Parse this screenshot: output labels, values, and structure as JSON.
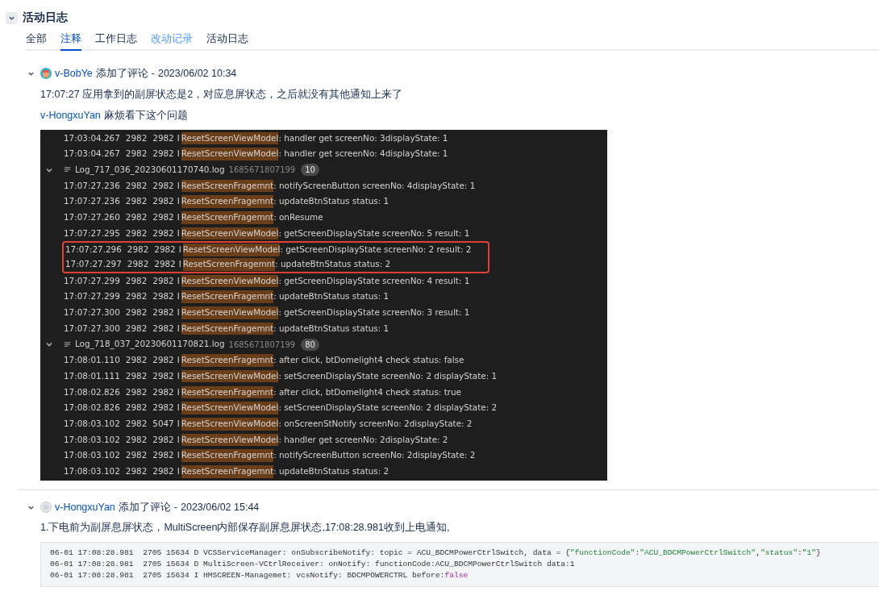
{
  "section": {
    "title": "活动日志",
    "expanded": true
  },
  "tabs": [
    {
      "label": "全部",
      "selected": false,
      "kind": "plain"
    },
    {
      "label": "注释",
      "selected": true,
      "kind": "plain"
    },
    {
      "label": "工作日志",
      "selected": false,
      "kind": "plain"
    },
    {
      "label": "改动记录",
      "selected": false,
      "kind": "link"
    },
    {
      "label": "活动日志",
      "selected": false,
      "kind": "plain"
    }
  ],
  "comments": [
    {
      "expanded": true,
      "avatar": {
        "kind": "cartoon"
      },
      "author": "v-BobYe",
      "action": "添加了评论",
      "separator": "-",
      "time": "2023/06/02 10:34",
      "body": [
        {
          "kind": "text",
          "text": "17:07:27 应用拿到的副屏状态是2，对应息屏状态，之后就没有其他通知上来了"
        },
        {
          "kind": "mention",
          "user": "v-HongxuYan",
          "text": "麻烦看下这个问题"
        },
        {
          "kind": "log_screenshot",
          "entries": [
            {
              "kind": "row",
              "time": "17:03:04.267",
              "pid": "2982",
              "tid": "2982",
              "level": "I",
              "tag": "ResetScreenViewModel",
              "message": ": handler get screenNo: 3displayState: 1",
              "boxed": false
            },
            {
              "kind": "row",
              "time": "17:03:04.267",
              "pid": "2982",
              "tid": "2982",
              "level": "I",
              "tag": "ResetScreenViewModel",
              "message": ": handler get screenNo: 4displayState: 1",
              "boxed": false
            },
            {
              "kind": "file",
              "name": "Log_717_036_20230601170740.log",
              "id": "1685671807199",
              "count": "10",
              "expanded": true
            },
            {
              "kind": "row",
              "time": "17:07:27.236",
              "pid": "2982",
              "tid": "2982",
              "level": "I",
              "tag": "ResetScreenFragemnt",
              "message": ": notifyScreenButton screenNo: 4displayState: 1",
              "boxed": false
            },
            {
              "kind": "row",
              "time": "17:07:27.236",
              "pid": "2982",
              "tid": "2982",
              "level": "I",
              "tag": "ResetScreenFragemnt",
              "message": ": updateBtnStatus status: 1",
              "boxed": false
            },
            {
              "kind": "row",
              "time": "17:07:27.260",
              "pid": "2982",
              "tid": "2982",
              "level": "I",
              "tag": "ResetScreenFragemnt",
              "message": ": onResume",
              "boxed": false
            },
            {
              "kind": "row",
              "time": "17:07:27.295",
              "pid": "2982",
              "tid": "2982",
              "level": "I",
              "tag": "ResetScreenViewModel",
              "message": ": getScreenDisplayState screenNo: 5 result: 1",
              "boxed": false
            },
            {
              "kind": "row",
              "time": "17:07:27.296",
              "pid": "2982",
              "tid": "2982",
              "level": "I",
              "tag": "ResetScreenViewModel",
              "message": ": getScreenDisplayState screenNo: 2 result: 2",
              "boxed": true
            },
            {
              "kind": "row",
              "time": "17:07:27.297",
              "pid": "2982",
              "tid": "2982",
              "level": "I",
              "tag": "ResetScreenFragemnt",
              "message": ": updateBtnStatus status: 2",
              "boxed": true
            },
            {
              "kind": "row",
              "time": "17:07:27.299",
              "pid": "2982",
              "tid": "2982",
              "level": "I",
              "tag": "ResetScreenViewModel",
              "message": ": getScreenDisplayState screenNo: 4 result: 1",
              "boxed": false
            },
            {
              "kind": "row",
              "time": "17:07:27.299",
              "pid": "2982",
              "tid": "2982",
              "level": "I",
              "tag": "ResetScreenFragemnt",
              "message": ": updateBtnStatus status: 1",
              "boxed": false
            },
            {
              "kind": "row",
              "time": "17:07:27.300",
              "pid": "2982",
              "tid": "2982",
              "level": "I",
              "tag": "ResetScreenViewModel",
              "message": ": getScreenDisplayState screenNo: 3 result: 1",
              "boxed": false
            },
            {
              "kind": "row",
              "time": "17:07:27.300",
              "pid": "2982",
              "tid": "2982",
              "level": "I",
              "tag": "ResetScreenFragemnt",
              "message": ": updateBtnStatus status: 1",
              "boxed": false
            },
            {
              "kind": "file",
              "name": "Log_718_037_20230601170821.log",
              "id": "1685671807199",
              "count": "80",
              "expanded": true
            },
            {
              "kind": "row",
              "time": "17:08:01.110",
              "pid": "2982",
              "tid": "2982",
              "level": "I",
              "tag": "ResetScreenFragemnt",
              "message": ": after click, btDomelight4 check status: false",
              "boxed": false
            },
            {
              "kind": "row",
              "time": "17:08:01.111",
              "pid": "2982",
              "tid": "2982",
              "level": "I",
              "tag": "ResetScreenViewModel",
              "message": ": setScreenDisplayState screenNo: 2 displayState: 1",
              "boxed": false
            },
            {
              "kind": "row",
              "time": "17:08:02.826",
              "pid": "2982",
              "tid": "2982",
              "level": "I",
              "tag": "ResetScreenFragemnt",
              "message": ": after click, btDomelight4 check status: true",
              "boxed": false
            },
            {
              "kind": "row",
              "time": "17:08:02.826",
              "pid": "2982",
              "tid": "2982",
              "level": "I",
              "tag": "ResetScreenViewModel",
              "message": ": setScreenDisplayState screenNo: 2 displayState: 2",
              "boxed": false
            },
            {
              "kind": "row",
              "time": "17:08:03.102",
              "pid": "2982",
              "tid": "5047",
              "level": "I",
              "tag": "ResetScreenViewModel",
              "message": ": onScreenStNotify screenNo: 2displayState: 2",
              "boxed": false
            },
            {
              "kind": "row",
              "time": "17:08:03.102",
              "pid": "2982",
              "tid": "2982",
              "level": "I",
              "tag": "ResetScreenViewModel",
              "message": ": handler get screenNo: 2displayState: 2",
              "boxed": false
            },
            {
              "kind": "row",
              "time": "17:08:03.102",
              "pid": "2982",
              "tid": "2982",
              "level": "I",
              "tag": "ResetScreenFragemnt",
              "message": ": notifyScreenButton screenNo: 2displayState: 2",
              "boxed": false
            },
            {
              "kind": "row",
              "time": "17:08:03.102",
              "pid": "2982",
              "tid": "2982",
              "level": "I",
              "tag": "ResetScreenFragemnt",
              "message": ": updateBtnStatus status: 2",
              "boxed": false
            }
          ]
        }
      ]
    },
    {
      "expanded": true,
      "avatar": {
        "kind": "default"
      },
      "author": "v-HongxuYan",
      "action": "添加了评论",
      "separator": "-",
      "time": "2023/06/02 15:44",
      "body": [
        {
          "kind": "text",
          "text": "1.下电前为副屏息屏状态，MultiScreen内部保存副屏息屏状态,17:08:28.981收到上电通知,"
        },
        {
          "kind": "code",
          "lines": [
            [
              {
                "kind": "plain",
                "text": "06-01 17:08:28.981  2705 15634 D VCSServiceManager: onSubscribeNotify: topic = ACU_BDCMPowerCtrlSwitch, data = {"
              },
              {
                "kind": "string",
                "text": "\"functionCode\""
              },
              {
                "kind": "plain",
                "text": ":"
              },
              {
                "kind": "string",
                "text": "\"ACU_BDCMPowerCtrlSwitch\""
              },
              {
                "kind": "plain",
                "text": ","
              },
              {
                "kind": "string",
                "text": "\"status\""
              },
              {
                "kind": "plain",
                "text": ":"
              },
              {
                "kind": "string",
                "text": "\"1\""
              },
              {
                "kind": "plain",
                "text": "}"
              }
            ],
            [
              {
                "kind": "plain",
                "text": "06-01 17:08:28.981  2705 15634 D MultiScreen-VCtrlReceiver: onNotify: functionCode:ACU_BDCMPowerCtrlSwitch data:1"
              }
            ],
            [
              {
                "kind": "plain",
                "text": "06-01 17:08:28.981  2705 15634 I HMSCREEN-Managemet: vcsNotify: BDCMPOWERCTRL before:"
              },
              {
                "kind": "keyword",
                "text": "false"
              }
            ]
          ]
        }
      ]
    }
  ]
}
